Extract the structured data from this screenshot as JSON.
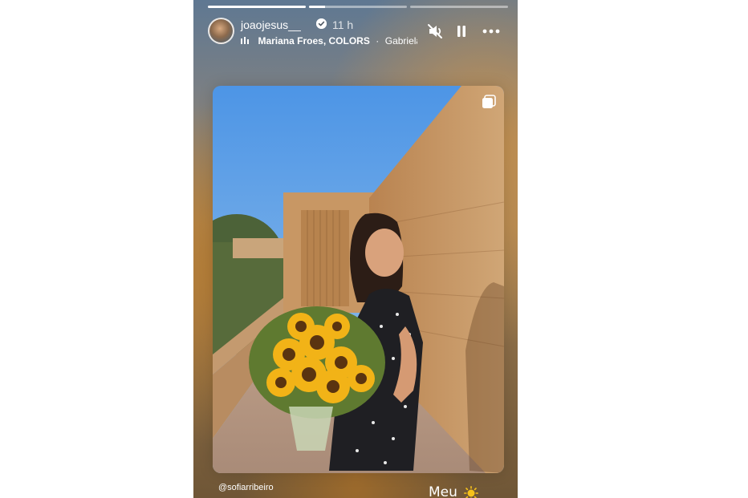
{
  "story": {
    "progress": [
      1.0,
      0.16,
      0.0
    ],
    "username": "joaojesus__",
    "time": "11 h",
    "music": {
      "artist": "Mariana Froes, COLORS",
      "separator": "·",
      "song": "Gabriela · A"
    },
    "controls": {
      "mute_icon": "speaker-muted-icon",
      "pause_icon": "pause-icon",
      "more_icon": "more-horizontal-icon"
    },
    "photo": {
      "multiple_icon": "carousel-multiple-icon"
    },
    "credit": "@sofiarribeiro",
    "caption": "Meu",
    "caption_emoji": "sun-emoji"
  },
  "colors": {
    "verified": "#3897f0",
    "sky": "#5ca0e6",
    "wall": "#c89a66"
  }
}
